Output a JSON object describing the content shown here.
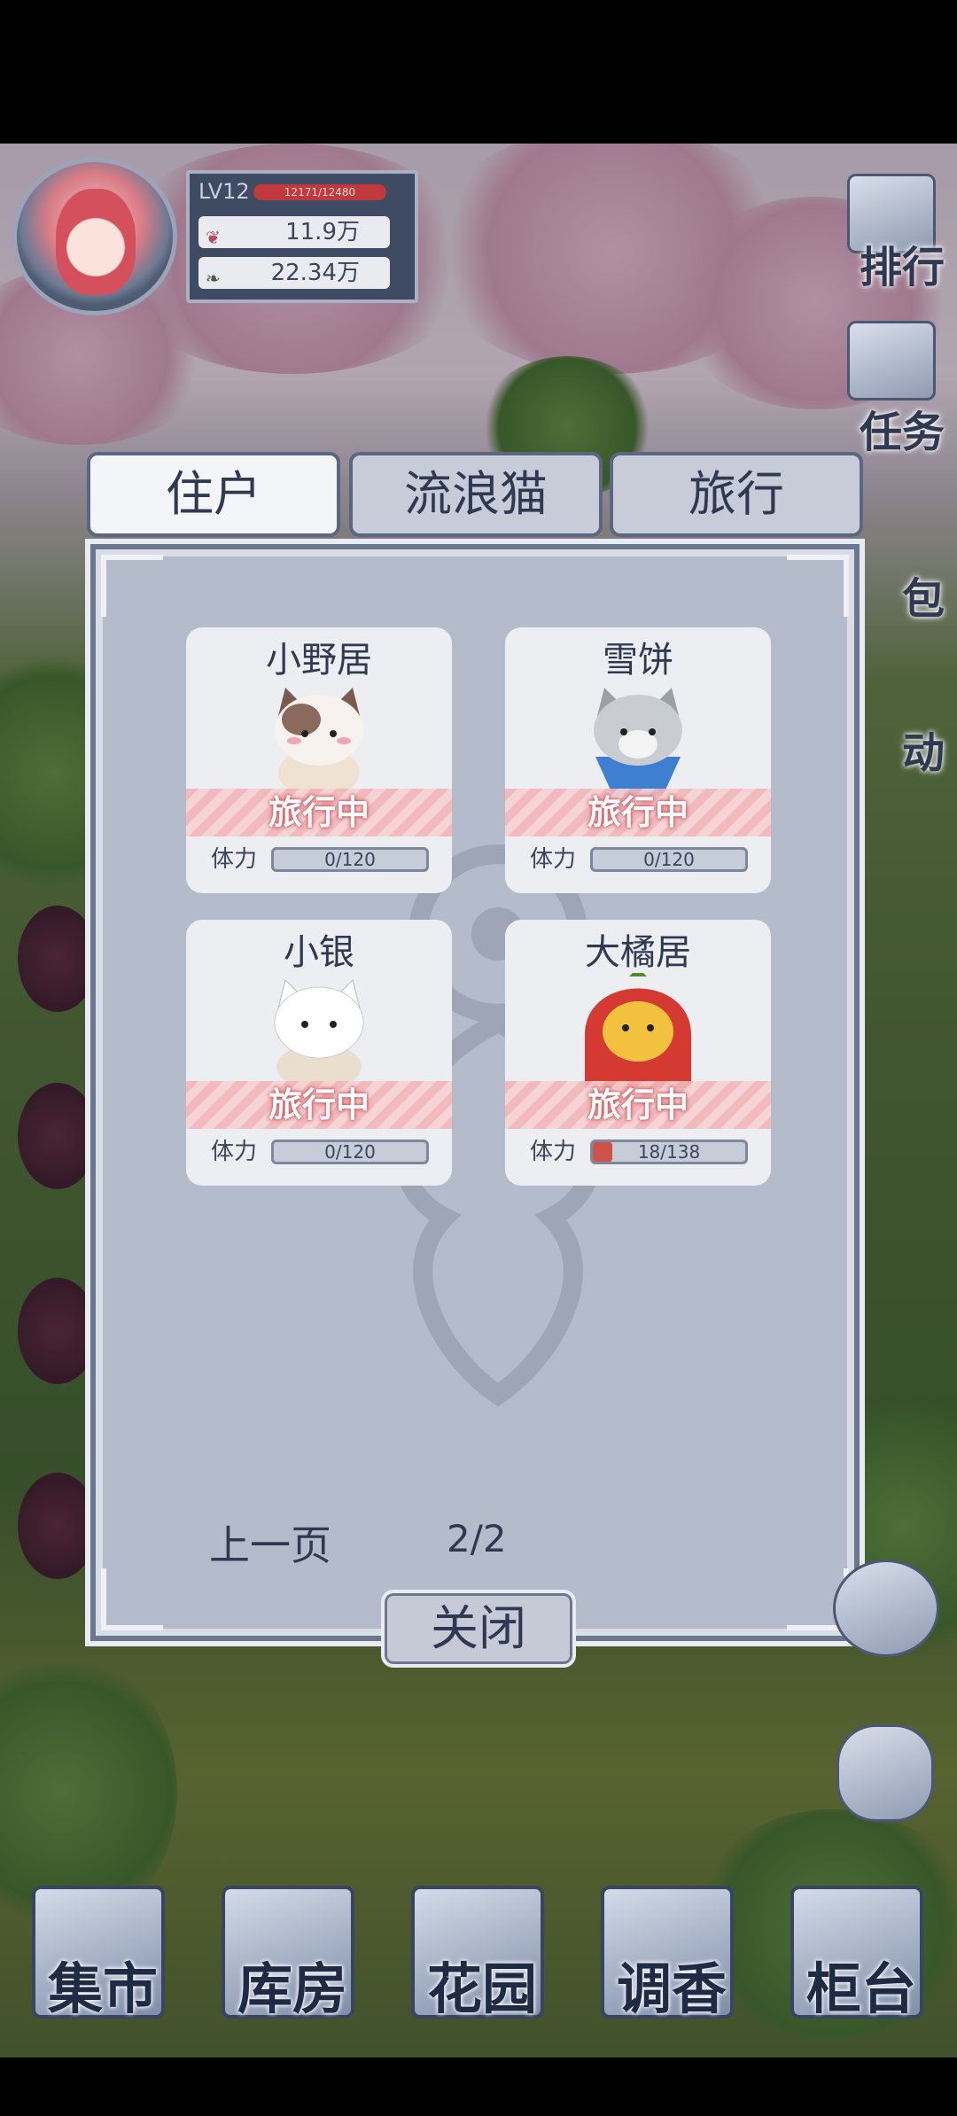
{
  "player": {
    "level": "LV12",
    "xp": "12171/12480",
    "stat1": "11.9万",
    "stat2": "22.34万"
  },
  "side_menu": [
    {
      "label": "排行",
      "icon": "ranking-icon"
    },
    {
      "label": "任务",
      "icon": "task-clipboard-icon"
    },
    {
      "label": "包",
      "icon": "bag-icon"
    },
    {
      "label": "动",
      "icon": "event-icon"
    }
  ],
  "tabs": [
    {
      "label": "住户",
      "active": true
    },
    {
      "label": "流浪猫",
      "active": false
    },
    {
      "label": "旅行",
      "active": false
    }
  ],
  "cats": [
    {
      "name": "小野居",
      "status": "旅行中",
      "stamina_label": "体力",
      "stamina": "0/120",
      "fill": 0
    },
    {
      "name": "雪饼",
      "status": "旅行中",
      "stamina_label": "体力",
      "stamina": "0/120",
      "fill": 0
    },
    {
      "name": "小银",
      "status": "旅行中",
      "stamina_label": "体力",
      "stamina": "0/120",
      "fill": 0
    },
    {
      "name": "大橘居",
      "status": "旅行中",
      "stamina_label": "体力",
      "stamina": "18/138",
      "fill": 0.13
    }
  ],
  "pager": {
    "prev": "上一页",
    "page": "2/2"
  },
  "close_label": "关闭",
  "bottom_nav": [
    {
      "label": "集市"
    },
    {
      "label": "库房"
    },
    {
      "label": "花园"
    },
    {
      "label": "调香"
    },
    {
      "label": "柜台"
    }
  ],
  "colors": {
    "accent": "#2f3a52",
    "status_stripe": "#f2b6b9",
    "stamina_fill": "#cf5249",
    "panel": "#b4bbcb"
  }
}
